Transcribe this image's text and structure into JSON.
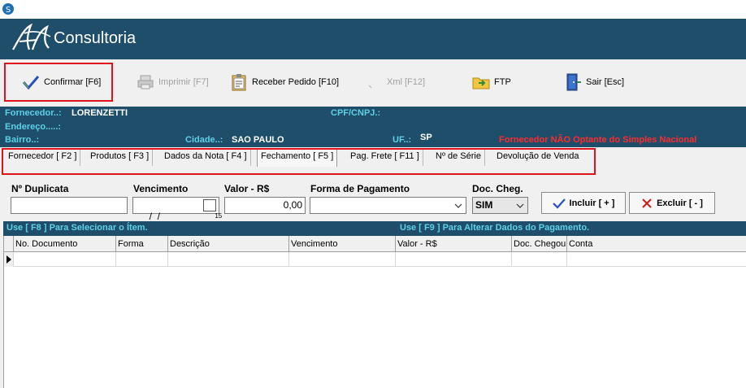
{
  "app": {
    "brand": "Consultoria"
  },
  "toolbar": {
    "confirm_label": "Confirmar [F6]",
    "print_label": "Imprimir  [F7]",
    "receive_label": "Receber Pedido [F10]",
    "xml_label": "Xml [F12]",
    "ftp_label": "FTP",
    "exit_label": "Sair [Esc]"
  },
  "info": {
    "supplier_label": "Fornecedor..:",
    "supplier_value": "LORENZETTI",
    "cpf_label": "CPF/CNPJ.:",
    "address_label": "Endereço.....:",
    "district_label": "Bairro..:",
    "city_label": "Cidade..:",
    "city_value": "SAO PAULO",
    "uf_label": "UF..:",
    "uf_value": "SP",
    "warning": "Fornecedor NÃO Optante do Simples Nacional"
  },
  "tabs": [
    {
      "label": "Fornecedor [ F2 ]"
    },
    {
      "label": "Produtos [ F3 ]"
    },
    {
      "label": "Dados da Nota [ F4 ]"
    },
    {
      "label": "Fechamento [ F5 ]"
    },
    {
      "label": "Pag. Frete [ F11 ]"
    },
    {
      "label": "Nº de Série"
    },
    {
      "label": "Devolução de Venda"
    }
  ],
  "form": {
    "duplicata_label": "Nº Duplicata",
    "duplicata_value": "",
    "vencimento_label": "Vencimento",
    "vencimento_value": " /  /",
    "valor_label": "Valor - R$",
    "valor_value": "0,00",
    "forma_label": "Forma de Pagamento",
    "forma_value": "",
    "doc_label": "Doc. Cheg.",
    "doc_value": "SIM",
    "include_label": "Incluir [ + ]",
    "exclude_label": "Excluir [ - ]",
    "calendar_day": "15"
  },
  "hints": {
    "left": "Use [ F8 ] Para Selecionar o Ítem.",
    "right": "Use [ F9 ] Para Alterar Dados do Pagamento."
  },
  "grid": {
    "columns": [
      "No. Documento",
      "Forma",
      "Descrição",
      "Vencimento",
      "Valor - R$",
      "Doc. Chegou",
      "Conta"
    ]
  },
  "colors": {
    "header_bg": "#1f4e6b",
    "label_cyan": "#5fd0e8",
    "warning_red": "#ff2b2b",
    "highlight_red": "#e0121c"
  }
}
